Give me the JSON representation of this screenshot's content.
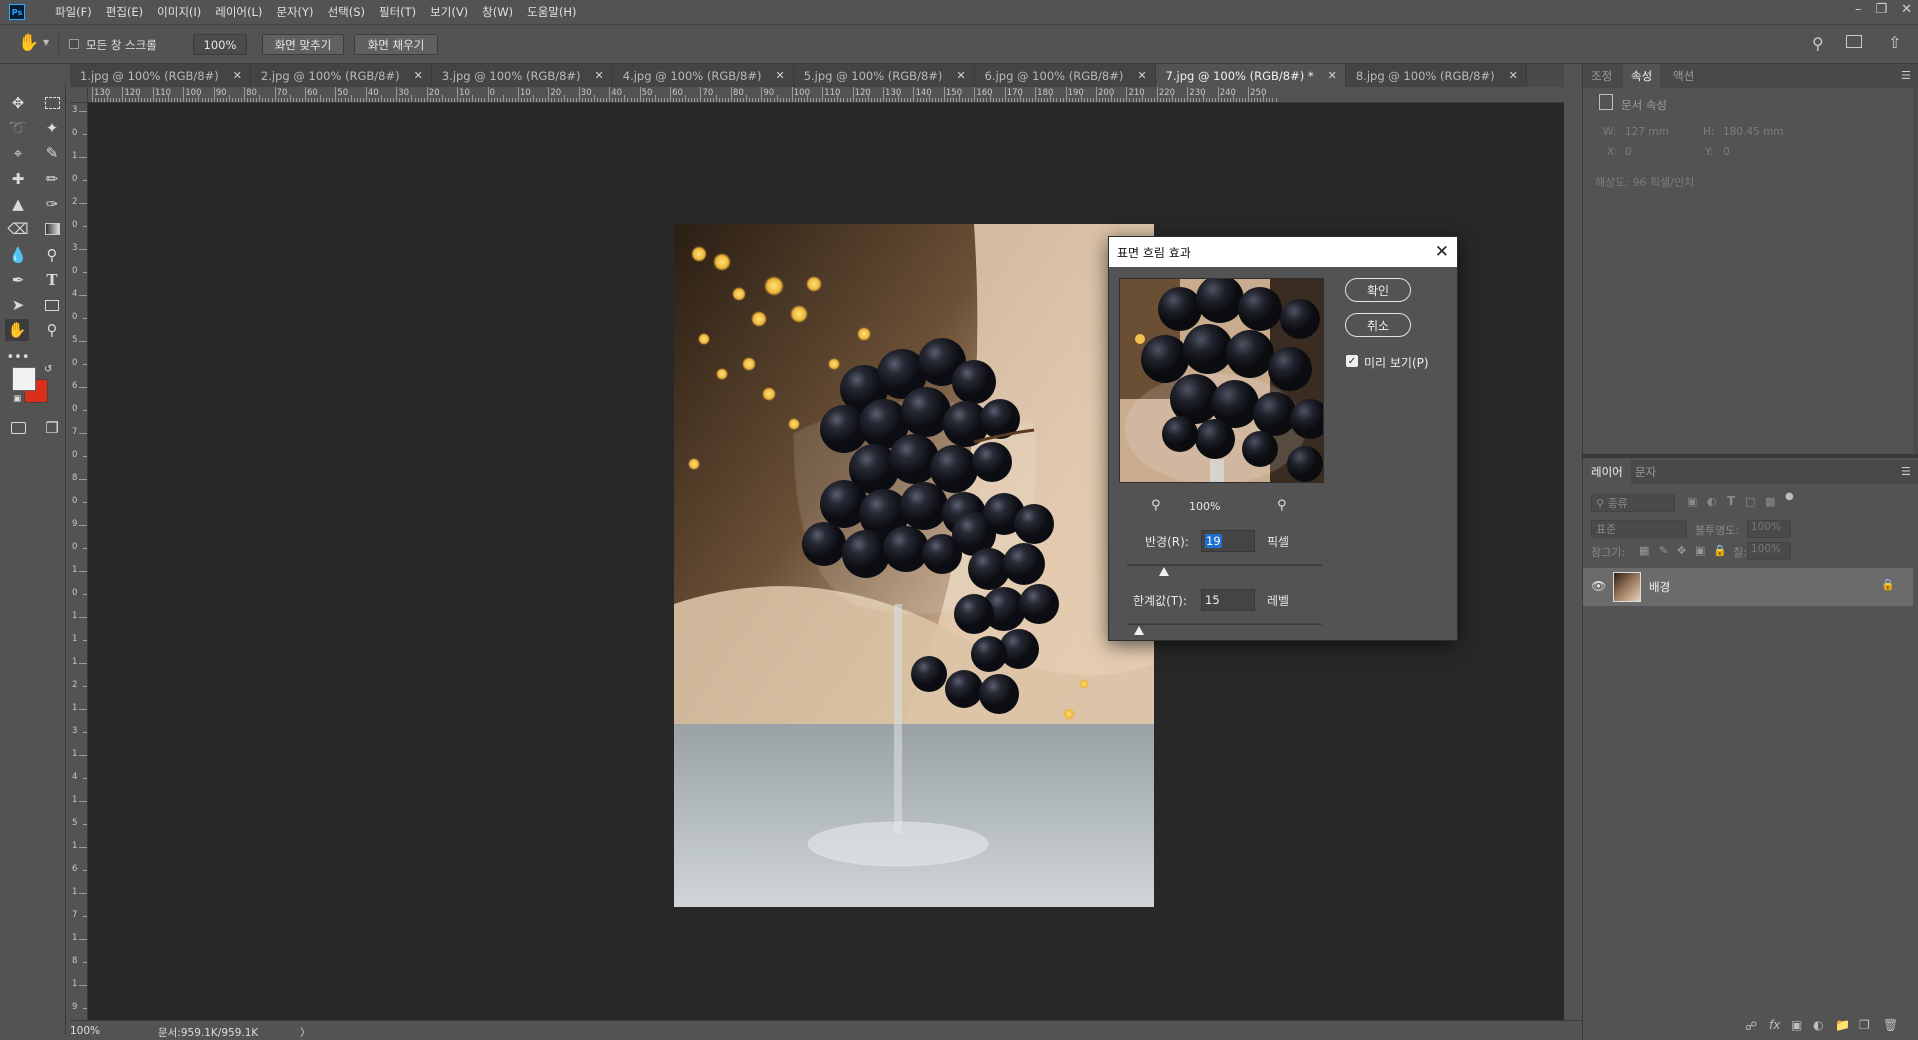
{
  "menubar": {
    "logo": "Ps",
    "items": [
      "파일(F)",
      "편집(E)",
      "이미지(I)",
      "레이어(L)",
      "문자(Y)",
      "선택(S)",
      "필터(T)",
      "보기(V)",
      "창(W)",
      "도움말(H)"
    ]
  },
  "options": {
    "scroll_all_label": "모든 창 스크롤",
    "zoom_value": "100%",
    "fit_screen_label": "화면 맞추기",
    "fill_screen_label": "화면 채우기"
  },
  "tabs": [
    {
      "label": "1.jpg @ 100% (RGB/8#)",
      "active": false
    },
    {
      "label": "2.jpg @ 100% (RGB/8#)",
      "active": false
    },
    {
      "label": "3.jpg @ 100% (RGB/8#)",
      "active": false
    },
    {
      "label": "4.jpg @ 100% (RGB/8#)",
      "active": false
    },
    {
      "label": "5.jpg @ 100% (RGB/8#)",
      "active": false
    },
    {
      "label": "6.jpg @ 100% (RGB/8#)",
      "active": false
    },
    {
      "label": "7.jpg @ 100% (RGB/8#) *",
      "active": true
    },
    {
      "label": "8.jpg @ 100% (RGB/8#)",
      "active": false
    }
  ],
  "ruler": {
    "h_ticks": [
      "130",
      "120",
      "110",
      "100",
      "90",
      "80",
      "70",
      "60",
      "50",
      "40",
      "30",
      "20",
      "10",
      "0",
      "10",
      "20",
      "30",
      "40",
      "50",
      "60",
      "70",
      "80",
      "90",
      "100",
      "110",
      "120",
      "130",
      "140",
      "150",
      "160",
      "170",
      "180",
      "190",
      "200",
      "210",
      "220",
      "230",
      "240",
      "250"
    ],
    "v_ticks": [
      "3",
      "0",
      "1",
      "0",
      "2",
      "0",
      "3",
      "0",
      "4",
      "0",
      "5",
      "0",
      "6",
      "0",
      "7",
      "0",
      "8",
      "0",
      "9",
      "0",
      "1",
      "0",
      "1",
      "1",
      "1",
      "2",
      "1",
      "3",
      "1",
      "4",
      "1",
      "5",
      "1",
      "6",
      "1",
      "7",
      "1",
      "8",
      "1",
      "9"
    ]
  },
  "status": {
    "zoom": "100%",
    "doc": "문서:959.1K/959.1K",
    "arrow": "〉"
  },
  "dialog": {
    "title": "표면 흐림 효과",
    "ok_label": "확인",
    "cancel_label": "취소",
    "preview_label": "미리 보기(P)",
    "preview_checked": true,
    "zoom_label": "100%",
    "radius_label": "반경(R):",
    "radius_value": "19",
    "radius_unit": "픽셀",
    "radius_fraction": 0.19,
    "threshold_label": "한계값(T):",
    "threshold_value": "15",
    "threshold_unit": "레벨",
    "threshold_fraction": 0.06
  },
  "properties_panel": {
    "tabs": [
      "조정",
      "속성",
      "액션"
    ],
    "active_tab": "속성",
    "doc_header": "문서 속성",
    "w_label": "W:",
    "w_value": "127 mm",
    "h_label": "H:",
    "h_value": "180.45 mm",
    "x_label": "X:",
    "x_value": "0",
    "y_label": "Y:",
    "y_value": "0",
    "resolution": "해상도: 96 픽셀/인치"
  },
  "layers_panel": {
    "tabs": [
      "레이어",
      "문자"
    ],
    "active_tab": "레이어",
    "filter_label": "종류",
    "blend_mode": "표준",
    "opacity_label": "불투명도:",
    "opacity_value": "100%",
    "lock_label": "잠그기:",
    "fill_label": "칠:",
    "fill_value": "100%",
    "layer_name": "배경"
  },
  "colors": {
    "foreground": "#f2f2f2",
    "background": "#d92e1a",
    "selection": "#1e6fd0"
  }
}
